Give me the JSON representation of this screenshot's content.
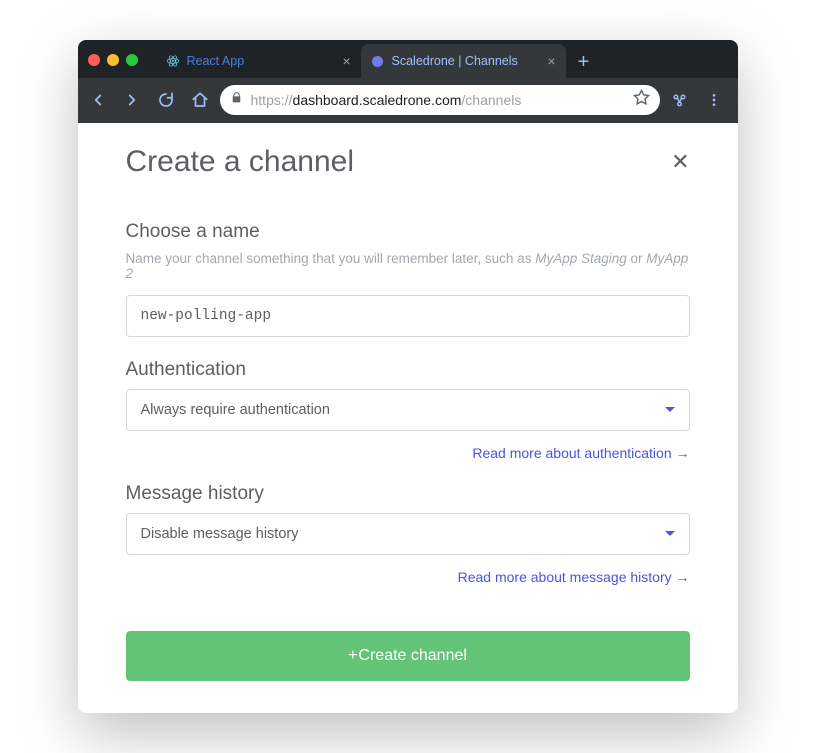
{
  "tabs": [
    {
      "title": "React App",
      "active": false
    },
    {
      "title": "Scaledrone | Channels",
      "active": true
    }
  ],
  "address": {
    "scheme": "https://",
    "host": "dashboard.scaledrone.com",
    "path": "/channels"
  },
  "page": {
    "title": "Create a channel"
  },
  "name_section": {
    "label": "Choose a name",
    "hint_prefix": "Name your channel something that you will remember later, such as ",
    "hint_em1": "MyApp Staging",
    "hint_mid": " or ",
    "hint_em2": "MyApp 2",
    "value": "new-polling-app"
  },
  "auth_section": {
    "label": "Authentication",
    "selected": "Always require authentication",
    "help": "Read more about authentication"
  },
  "history_section": {
    "label": "Message history",
    "selected": "Disable message history",
    "help": "Read more about message history"
  },
  "create_button": {
    "label": "Create channel"
  }
}
